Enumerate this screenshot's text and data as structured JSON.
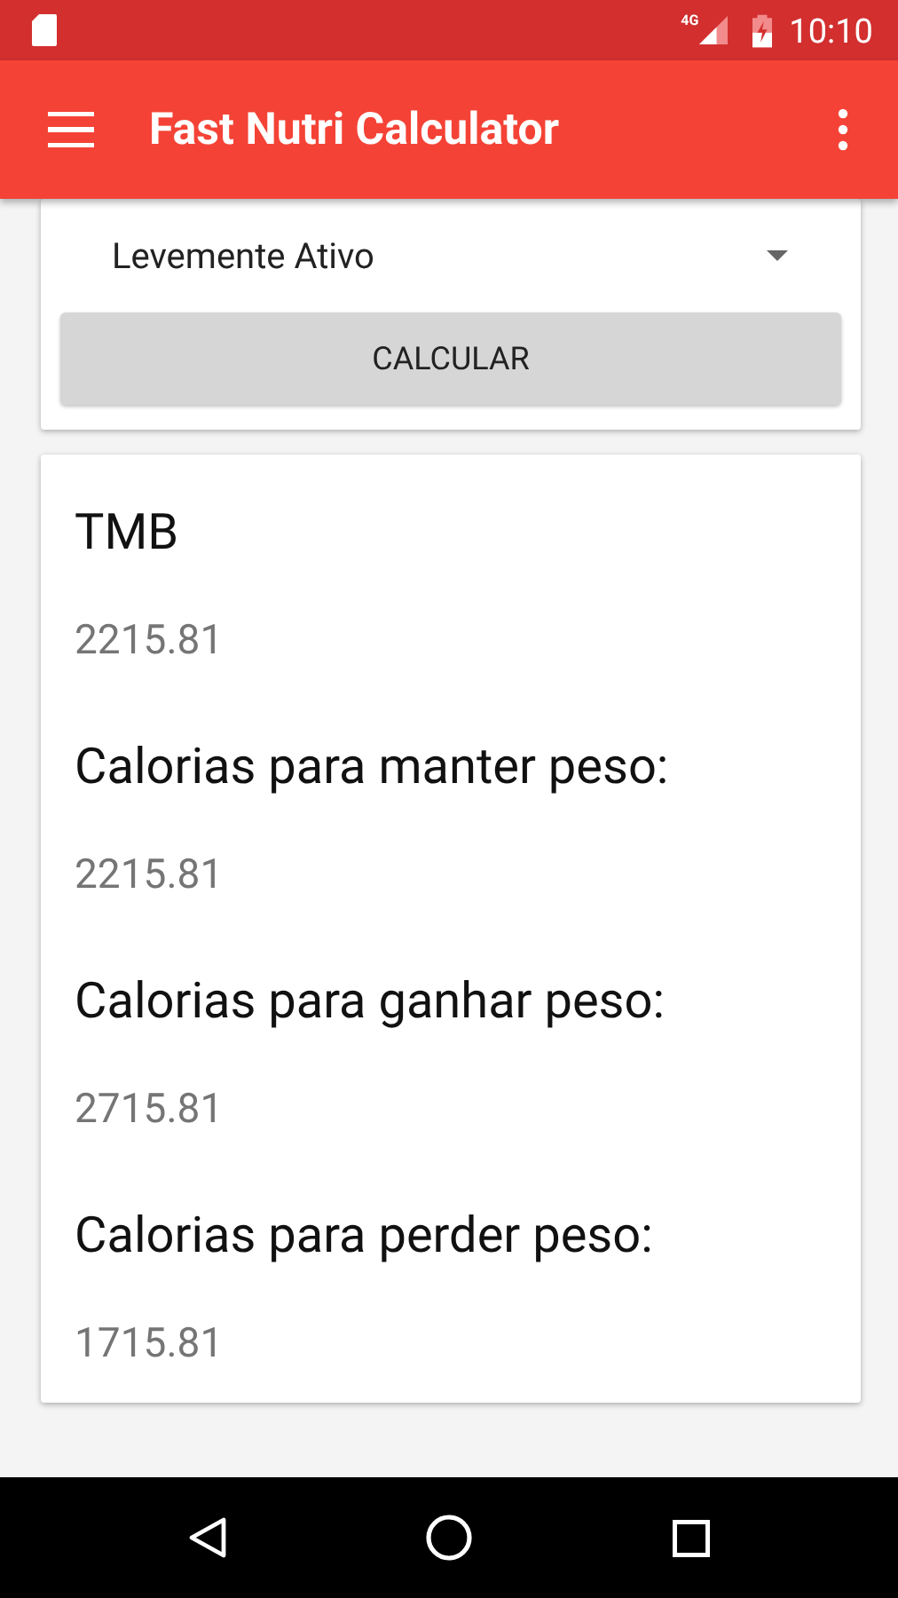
{
  "status_bar": {
    "network": "4G",
    "time": "10:10"
  },
  "toolbar": {
    "title": "Fast Nutri Calculator"
  },
  "activity_spinner": {
    "value": "Levemente Ativo"
  },
  "calculate_button": {
    "label": "CALCULAR"
  },
  "results": [
    {
      "label": "TMB",
      "value": "2215.81"
    },
    {
      "label": "Calorias para manter peso:",
      "value": "2215.81"
    },
    {
      "label": "Calorias para ganhar peso:",
      "value": "2715.81"
    },
    {
      "label": "Calorias para perder peso:",
      "value": "1715.81"
    }
  ]
}
